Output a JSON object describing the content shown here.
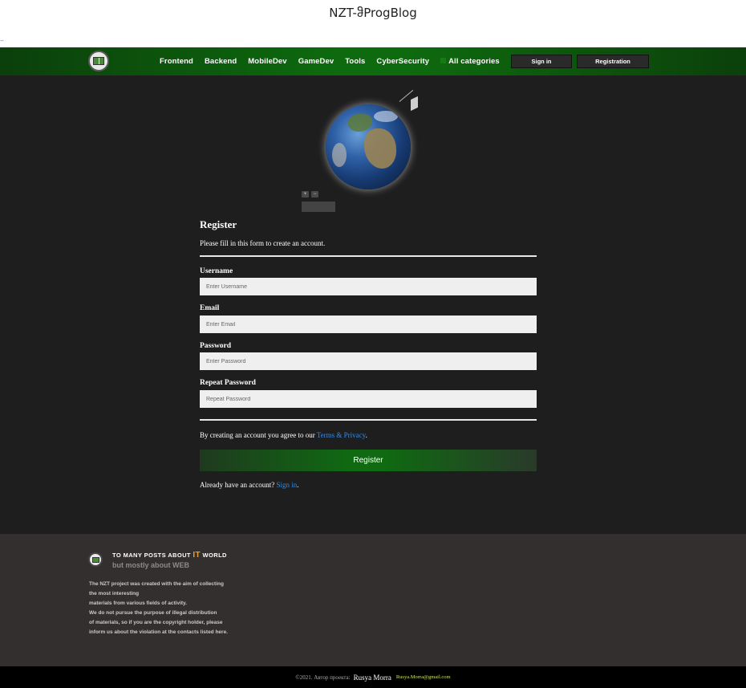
{
  "page": {
    "title": "NZT-ჵProgBlog",
    "dots": ".."
  },
  "navbar": {
    "links": [
      "Frontend",
      "Backend",
      "MobileDev",
      "GameDev",
      "Tools",
      "CyberSecurity"
    ],
    "all_categories": "All categories",
    "signin": "Sign in",
    "registration": "Registration"
  },
  "globe": {
    "zoom_in": "+",
    "zoom_out": "−"
  },
  "form": {
    "heading": "Register",
    "subtitle": "Please fill in this form to create an account.",
    "username_label": "Username",
    "username_placeholder": "Enter Username",
    "email_label": "Email",
    "email_placeholder": "Enter Email",
    "password_label": "Password",
    "password_placeholder": "Enter Password",
    "repeat_label": "Repeat Password",
    "repeat_placeholder": "Repeat Password",
    "terms_prefix": "By creating an account you agree to our ",
    "terms_link": "Terms & Privacy",
    "terms_suffix": ".",
    "submit": "Register",
    "already_prefix": "Already have an account? ",
    "already_link": "Sign in",
    "already_suffix": "."
  },
  "footer": {
    "head_prefix": "TO MANY POSTS ABOUT ",
    "head_it": "IT",
    "head_suffix": " WORLD",
    "subhead": "but mostly about WEB",
    "lines": [
      "The NZT project was created with the aim of collecting",
      "the most interesting",
      "materials from various fields of activity.",
      "We do not pursue the purpose of illegal distribution",
      "of materials, so if you are the copyright holder, please",
      "inform us about the violation at the contacts listed here."
    ]
  },
  "bottom": {
    "copyright": "©2021. Автор проекта:",
    "author": "Rusya Morra",
    "email": "Rusya.Morra@gmail.com"
  },
  "colors": {
    "nav_green": "#0d6a0e",
    "main_bg": "#1e1e1e",
    "footer_bg": "#332f2f",
    "link_blue": "#3a8ad9",
    "it_orange": "#f0a020",
    "email_green": "#c8e64a"
  }
}
